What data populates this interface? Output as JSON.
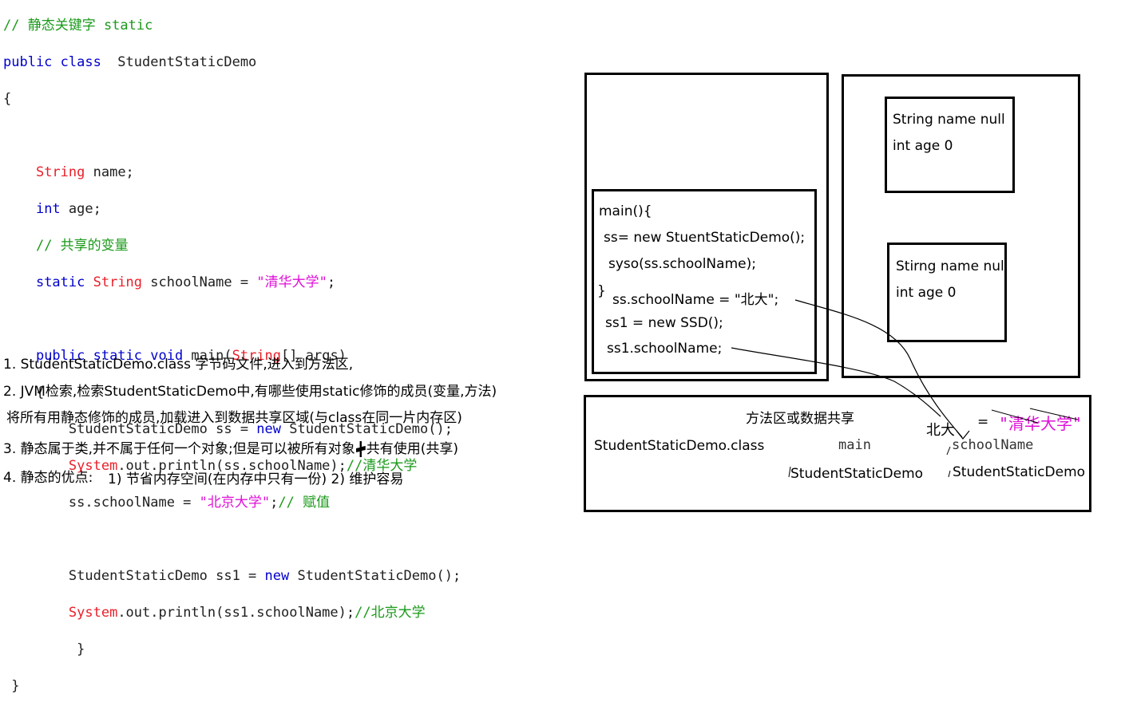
{
  "code": {
    "line1": {
      "comment": "// 静态关键字 static"
    },
    "line2": {
      "kw": "public class",
      "name": "  StudentStaticDemo"
    },
    "line3": {
      "text": "{"
    },
    "line5": {
      "type": "String",
      "rest": " name;"
    },
    "line6": {
      "kw": "int",
      "rest": " age;"
    },
    "line7": {
      "comment": "// 共享的变量"
    },
    "line8": {
      "kw": "static",
      "type": " String",
      "rest": " schoolName = ",
      "str": "\"清华大学\"",
      "end": ";"
    },
    "line10": {
      "kw": "public static void",
      "rest": " main(",
      "type": "String",
      "rest2": "[] args)"
    },
    "line11": {
      "text": "{"
    },
    "line12": {
      "pre": "StudentStaticDemo ss = ",
      "kw": "new",
      "post": " StudentStaticDemo();"
    },
    "line13": {
      "type": "System",
      "rest": ".out.println(ss.schoolName);",
      "comment": "//清华大学"
    },
    "line14": {
      "pre": "ss.schoolName = ",
      "str": "\"北京大学\"",
      "mid": ";",
      "comment": "// 赋值"
    },
    "line16": {
      "pre": "StudentStaticDemo ss1 = ",
      "kw": "new",
      "post": " StudentStaticDemo();"
    },
    "line17": {
      "type": "System",
      "rest": ".out.println(ss1.schoolName);",
      "comment": "//北京大学"
    },
    "line18": {
      "text": "}"
    },
    "line19": {
      "text": "}"
    }
  },
  "notes": {
    "n1": "1. StudentStaticDemo.class 字节码文件,进入到方法区,",
    "n2": "2. JVM检索,检索StudentStaticDemo中,有哪些使用static修饰的成员(变量,方法)",
    "n2b": "将所有用静态修饰的成员,加载进入到数据共享区域(与class在同一片内存区)",
    "n3": "3. 静态属于类,并不属于任何一个对象;但是可以被所有对象",
    "n3b": "共有使用(共享)",
    "n4": "4. 静态的优点:",
    "n4b": "1) 节省内存空间(在内存中只有一份) 2) 维护容易"
  },
  "diagram": {
    "stack": {
      "l1": "main(){",
      "l2": "ss= new StuentStaticDemo();",
      "l3": "syso(ss.schoolName);",
      "l4a": "}",
      "l4": "ss.schoolName = \"北大\";",
      "l5": "ss1 = new SSD();",
      "l6": "ss1.schoolName;"
    },
    "heap": {
      "obj1_l1": "String name null",
      "obj1_l2": "int age 0",
      "obj2_l1": "Stirng name null",
      "obj2_l2": "int age 0"
    },
    "method_area": {
      "title": "方法区或数据共享",
      "class_label": "StudentStaticDemo.class",
      "main_label": "main",
      "main_owner": "StudentStaticDemo",
      "school_label": "schoolName",
      "school_owner": "StudentStaticDemo",
      "new_value": "北大",
      "equals": "=",
      "old_value": "\"清华大学\""
    }
  },
  "colors": {
    "keyword": "#0000cc",
    "type": "#e8202a",
    "comment": "#1a9a1a",
    "string": "#e010d8"
  }
}
